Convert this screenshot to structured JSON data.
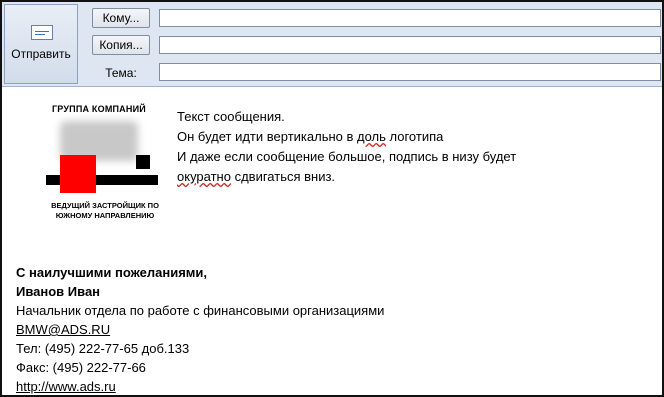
{
  "toolbar": {
    "send_label": "Отправить",
    "to_label": "Кому...",
    "cc_label": "Копия...",
    "subject_label": "Тема:"
  },
  "fields": {
    "to_value": "",
    "cc_value": "",
    "subject_value": ""
  },
  "logo": {
    "line1": "ГРУППА КОМПАНИЙ",
    "line2": "ВЕДУЩИЙ ЗАСТРОЙЩИК ПО ЮЖНОМУ НАПРАВЛЕНИЮ"
  },
  "message": {
    "line1": "Текст сообщения.",
    "line2_a": "Он будет идти вертикально в ",
    "line2_b": "доль",
    "line2_c": " логотипа",
    "line3": "И даже если сообщение большое, подпись в низу будет",
    "line4_a": "окуратно",
    "line4_b": " сдвигаться вниз."
  },
  "signature": {
    "greeting": "С наилучшими пожеланиями,",
    "name": "Иванов Иван",
    "title": "Начальник отдела по работе с финансовыми организациями",
    "email": "BMW@ADS.RU",
    "phone": "Тел:  (495) 222-77-65  доб.133",
    "fax": "Факс: (495) 222-77-66",
    "website": "http://www.ads.ru"
  },
  "colors": {
    "header_bg": "#dde6f1",
    "logo_red": "#ff0000"
  }
}
